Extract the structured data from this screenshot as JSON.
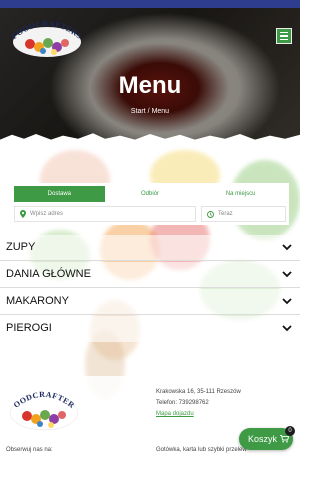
{
  "brand": {
    "logo_text": "FOODCRAFTERS"
  },
  "hero": {
    "title": "Menu",
    "breadcrumb_start": "Start",
    "breadcrumb_sep": "/",
    "breadcrumb_current": "Menu"
  },
  "order": {
    "tabs": [
      {
        "label": "Dostawa",
        "active": true
      },
      {
        "label": "Odbiór",
        "active": false
      },
      {
        "label": "Na miejscu",
        "active": false
      }
    ],
    "address_placeholder": "Wpisz adres",
    "time_value": "Teraz"
  },
  "categories": [
    {
      "label": "ZUPY"
    },
    {
      "label": "DANIA GŁÓWNE"
    },
    {
      "label": "MAKARONY"
    },
    {
      "label": "PIEROGI"
    }
  ],
  "footer": {
    "address": "Krakowska 16, 35-111 Rzeszów",
    "phone": "Telefon: 739298762",
    "map_link": "Mapa dojazdu",
    "follow": "Obserwuj nas na:",
    "payment": "Gotówka, karta lub szybki przelew"
  },
  "cart": {
    "label": "Koszyk",
    "count": "0"
  },
  "colors": {
    "accent": "#3e9a45",
    "topbar": "#2f3d8f"
  }
}
